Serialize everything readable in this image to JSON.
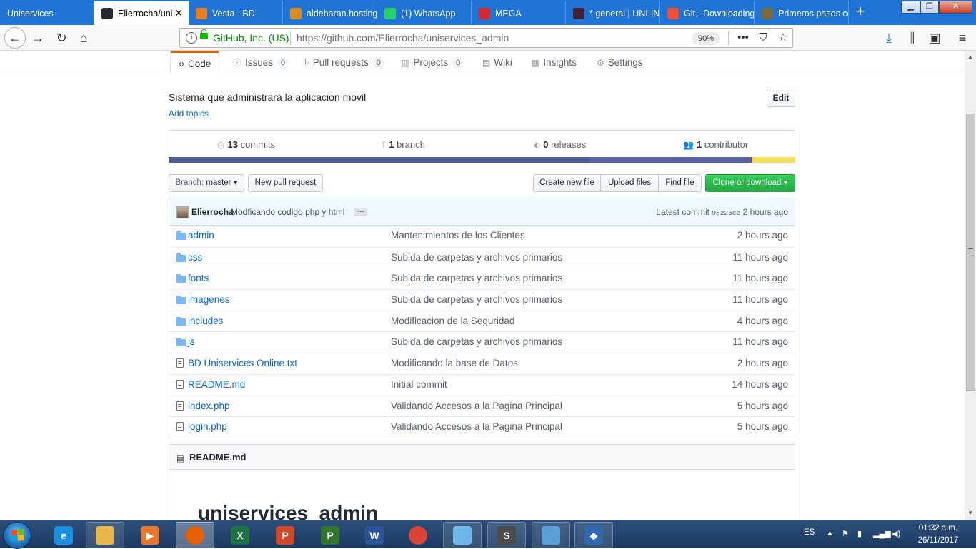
{
  "browser": {
    "tabs": [
      {
        "title": "Uniservices",
        "icon": "",
        "active": false
      },
      {
        "title": "Elierrocha/uniservices_admin",
        "icon": "github-icon",
        "active": true
      },
      {
        "title": "Vesta - BD",
        "icon": "vesta-icon",
        "active": false
      },
      {
        "title": "aldebaran.hosting",
        "icon": "aldebaran-icon",
        "active": false
      },
      {
        "title": "(1) WhatsApp",
        "icon": "whatsapp-icon",
        "active": false
      },
      {
        "title": "MEGA",
        "icon": "mega-icon",
        "active": false
      },
      {
        "title": "* general | UNI-IN",
        "icon": "slack-icon",
        "active": false
      },
      {
        "title": "Git - Downloading",
        "icon": "git-icon",
        "active": false
      },
      {
        "title": "Primeros pasos co",
        "icon": "page-icon",
        "active": false
      }
    ],
    "identity": "GitHub, Inc. (US)",
    "url_prefix": "https://github.com",
    "url_path": "/Elierrocha/uniservices_admin",
    "zoom": "90%"
  },
  "repo_nav": [
    {
      "label": "Code",
      "icon": "code-icon",
      "counter": null,
      "selected": true
    },
    {
      "label": "Issues",
      "icon": "issue-icon",
      "counter": "0",
      "selected": false
    },
    {
      "label": "Pull requests",
      "icon": "pull-request-icon",
      "counter": "0",
      "selected": false
    },
    {
      "label": "Projects",
      "icon": "project-icon",
      "counter": "0",
      "selected": false
    },
    {
      "label": "Wiki",
      "icon": "book-icon",
      "counter": null,
      "selected": false
    },
    {
      "label": "Insights",
      "icon": "graph-icon",
      "counter": null,
      "selected": false
    },
    {
      "label": "Settings",
      "icon": "gear-icon",
      "counter": null,
      "selected": false
    }
  ],
  "repo": {
    "description": "Sistema que administrará la aplicacion movil",
    "add_topics": "Add topics",
    "edit_label": "Edit"
  },
  "summary": {
    "commits_count": "13",
    "commits_label": "commits",
    "branch_count": "1",
    "branch_label": "branch",
    "releases_count": "0",
    "releases_label": "releases",
    "contributor_count": "1",
    "contributor_label": "contributor"
  },
  "language_bar": [
    {
      "color": "#4F5D95",
      "share": 0.67
    },
    {
      "color": "#563d7c",
      "share": 0.0
    },
    {
      "color": "#5b63a5",
      "share": 0.26
    },
    {
      "color": "#f1e05a",
      "share": 0.07
    }
  ],
  "buttons": {
    "branch_prefix": "Branch:",
    "branch_name": "master",
    "new_pull_request": "New pull request",
    "create_new_file": "Create new file",
    "upload_files": "Upload files",
    "find_file": "Find file",
    "clone_or_download": "Clone or download"
  },
  "latest_commit": {
    "author": "Elierrocha",
    "message": "Modficando codigo php y html",
    "label": "Latest commit",
    "sha": "98225ce",
    "age": "2 hours ago"
  },
  "files": [
    {
      "type": "dir",
      "name": "admin",
      "message": "Mantenimientos de los Clientes",
      "age": "2 hours ago"
    },
    {
      "type": "dir",
      "name": "css",
      "message": "Subida de carpetas y archivos primarios",
      "age": "11 hours ago"
    },
    {
      "type": "dir",
      "name": "fonts",
      "message": "Subida de carpetas y archivos primarios",
      "age": "11 hours ago"
    },
    {
      "type": "dir",
      "name": "imagenes",
      "message": "Subida de carpetas y archivos primarios",
      "age": "11 hours ago"
    },
    {
      "type": "dir",
      "name": "includes",
      "message": "Modificacion de la Seguridad",
      "age": "4 hours ago"
    },
    {
      "type": "dir",
      "name": "js",
      "message": "Subida de carpetas y archivos primarios",
      "age": "11 hours ago"
    },
    {
      "type": "file",
      "name": "BD Uniservices Online.txt",
      "message": "Modificando la base de Datos",
      "age": "2 hours ago"
    },
    {
      "type": "file",
      "name": "README.md",
      "message": "Initial commit",
      "age": "14 hours ago"
    },
    {
      "type": "file",
      "name": "index.php",
      "message": "Validando Accesos a la Pagina Principal",
      "age": "5 hours ago"
    },
    {
      "type": "file",
      "name": "login.php",
      "message": "Validando Accesos a la Pagina Principal",
      "age": "5 hours ago"
    }
  ],
  "readme": {
    "filename": "README.md",
    "heading": "uniservices_admin"
  },
  "taskbar": {
    "apps": [
      {
        "name": "internet-explorer-icon",
        "color": "#1b8fe0",
        "glyph": "e"
      },
      {
        "name": "file-explorer-icon",
        "color": "#e8b64a",
        "glyph": ""
      },
      {
        "name": "media-player-icon",
        "color": "#e8762b",
        "glyph": "▶"
      },
      {
        "name": "firefox-icon",
        "color": "#e66000",
        "glyph": ""
      },
      {
        "name": "excel-icon",
        "color": "#1f7244",
        "glyph": "X"
      },
      {
        "name": "powerpoint-icon",
        "color": "#d24726",
        "glyph": "P"
      },
      {
        "name": "project-icon",
        "color": "#31752f",
        "glyph": "P"
      },
      {
        "name": "word-icon",
        "color": "#2b579a",
        "glyph": "W"
      },
      {
        "name": "chrome-icon",
        "color": "#db4437",
        "glyph": ""
      },
      {
        "name": "notepad-icon",
        "color": "#6fb7e8",
        "glyph": ""
      },
      {
        "name": "sublime-text-icon",
        "color": "#4b4b4b",
        "glyph": "S"
      },
      {
        "name": "photo-viewer-icon",
        "color": "#5aa0d6",
        "glyph": ""
      },
      {
        "name": "sourcetree-icon",
        "color": "#2f6ab1",
        "glyph": "◆"
      }
    ],
    "language": "ES",
    "time": "01:32 a.m.",
    "date": "26/11/2017"
  }
}
